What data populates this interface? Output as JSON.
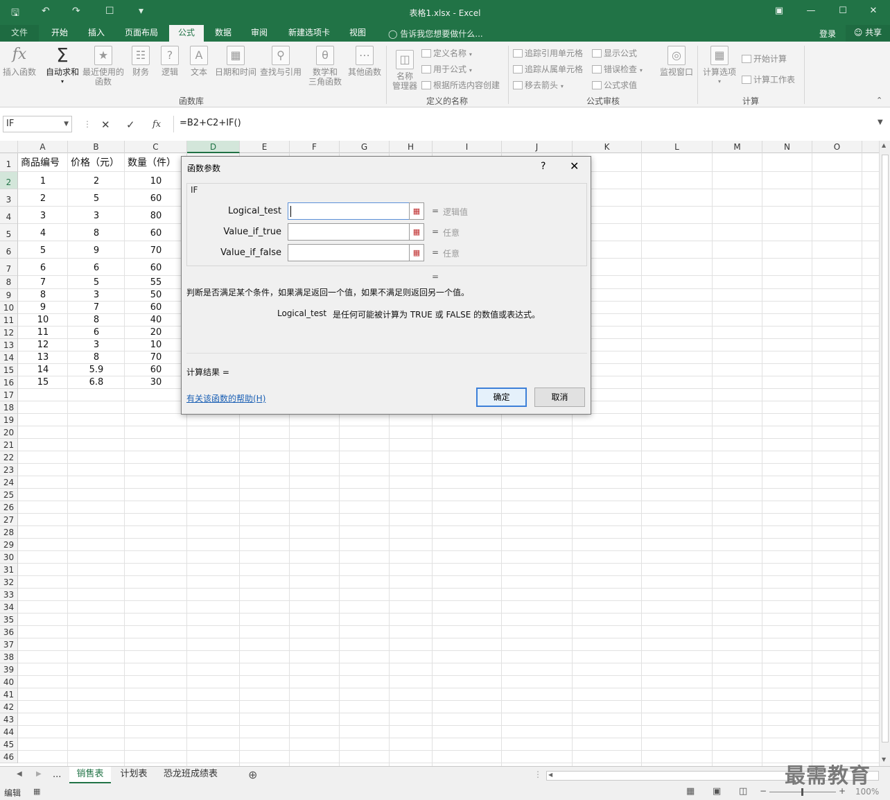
{
  "window": {
    "title": "表格1.xlsx - Excel",
    "qa_icons": [
      "save-icon",
      "undo-icon",
      "redo-icon",
      "new-icon",
      "customize-icon"
    ],
    "controls": [
      "ribbon-options-icon",
      "minimize-icon",
      "maximize-icon",
      "close-icon"
    ]
  },
  "tabs": [
    {
      "label": "文件"
    },
    {
      "label": "开始"
    },
    {
      "label": "插入"
    },
    {
      "label": "页面布局"
    },
    {
      "label": "公式",
      "active": true
    },
    {
      "label": "数据"
    },
    {
      "label": "审阅"
    },
    {
      "label": "新建选项卡"
    },
    {
      "label": "视图"
    }
  ],
  "tellme": "告诉我您想要做什么...",
  "login": "登录",
  "share": "共享",
  "ribbon": {
    "library": {
      "label": "函数库",
      "insert_function": "插入函数",
      "autosum": "自动求和",
      "recent_line1": "最近使用的",
      "recent_line2": "函数",
      "financial": "财务",
      "logical": "逻辑",
      "text": "文本",
      "datetime": "日期和时间",
      "lookup": "查找与引用",
      "math_line1": "数学和",
      "math_line2": "三角函数",
      "more": "其他函数"
    },
    "names": {
      "label": "定义的名称",
      "name_manager_line1": "名称",
      "name_manager_line2": "管理器",
      "define_name": "定义名称",
      "use_in_formula": "用于公式",
      "create_from_selection": "根据所选内容创建"
    },
    "audit": {
      "label": "公式审核",
      "trace_precedents": "追踪引用单元格",
      "trace_dependents": "追踪从属单元格",
      "remove_arrows": "移去箭头",
      "show_formulas": "显示公式",
      "error_checking": "错误检查",
      "evaluate": "公式求值",
      "watch_window": "监视窗口"
    },
    "calc": {
      "label": "计算",
      "options": "计算选项",
      "calc_now": "开始计算",
      "calc_sheet": "计算工作表"
    }
  },
  "formula_bar": {
    "name_box": "IF",
    "formula": "=B2+C2+IF()"
  },
  "columns": [
    "A",
    "B",
    "C",
    "D",
    "E",
    "F",
    "G",
    "H",
    "I",
    "J",
    "K",
    "L",
    "M",
    "N",
    "O"
  ],
  "header_row": [
    "商品编号",
    "价格（元）",
    "数量（件）"
  ],
  "rows": [
    [
      "1",
      "2",
      "10"
    ],
    [
      "2",
      "5",
      "60"
    ],
    [
      "3",
      "3",
      "80"
    ],
    [
      "4",
      "8",
      "60"
    ],
    [
      "5",
      "9",
      "70"
    ],
    [
      "6",
      "6",
      "60"
    ],
    [
      "7",
      "5",
      "55"
    ],
    [
      "8",
      "3",
      "50"
    ],
    [
      "9",
      "7",
      "60"
    ],
    [
      "10",
      "8",
      "40"
    ],
    [
      "11",
      "6",
      "20"
    ],
    [
      "12",
      "3",
      "10"
    ],
    [
      "13",
      "8",
      "70"
    ],
    [
      "14",
      "5.9",
      "60"
    ],
    [
      "15",
      "6.8",
      "30"
    ]
  ],
  "row_numbers": [
    "1",
    "2",
    "3",
    "4",
    "5",
    "6",
    "7",
    "8",
    "9",
    "10",
    "11",
    "12",
    "13",
    "14",
    "15",
    "16",
    "17",
    "18",
    "19",
    "20",
    "21",
    "22",
    "23",
    "24",
    "25",
    "26",
    "27",
    "28",
    "29",
    "30",
    "31",
    "32",
    "33",
    "34",
    "35",
    "36",
    "37",
    "38",
    "39",
    "40",
    "41",
    "42",
    "43",
    "44",
    "45",
    "46"
  ],
  "dialog": {
    "title": "函数参数",
    "help_glyph": "?",
    "function_name": "IF",
    "params": [
      {
        "label": "Logical_test",
        "hint": "逻辑值"
      },
      {
        "label": "Value_if_true",
        "hint": "任意"
      },
      {
        "label": "Value_if_false",
        "hint": "任意"
      }
    ],
    "eq": "=",
    "description": "判断是否满足某个条件，如果满足返回一个值，如果不满足则返回另一个值。",
    "param_name": "Logical_test",
    "param_desc": "是任何可能被计算为 TRUE 或 FALSE 的数值或表达式。",
    "result_label": "计算结果 =",
    "help_link": "有关该函数的帮助(H)",
    "ok": "确定",
    "cancel": "取消"
  },
  "sheets": {
    "ellipsis": "...",
    "tabs": [
      "销售表",
      "计划表",
      "恐龙班成绩表"
    ],
    "active": 0
  },
  "status": {
    "mode": "编辑",
    "zoom": "100%"
  },
  "watermark": "最需教育"
}
